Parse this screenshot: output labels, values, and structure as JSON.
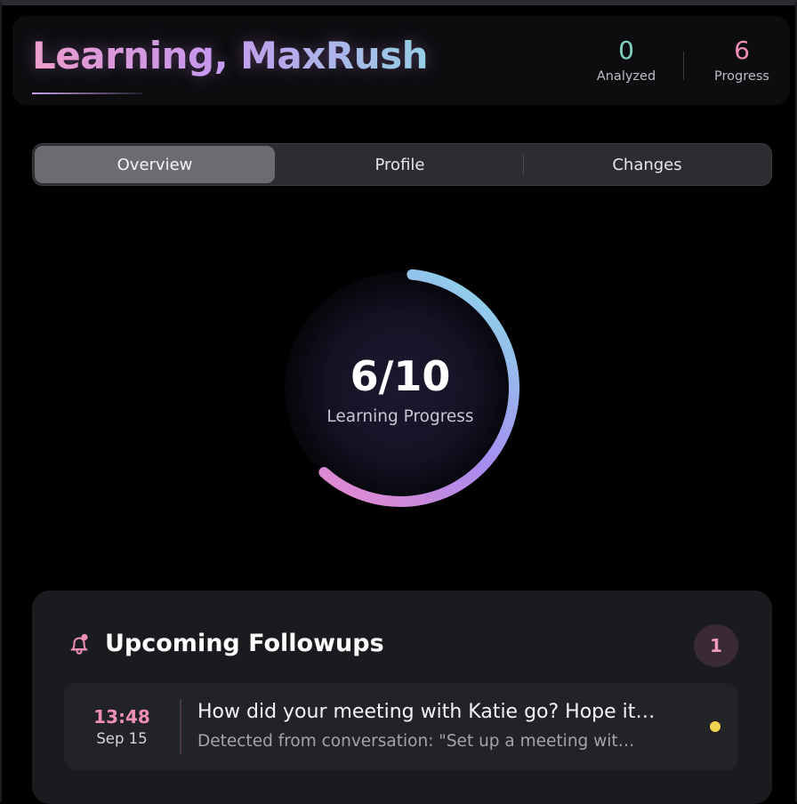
{
  "header": {
    "title": "Learning, MaxRush",
    "stats": {
      "analyzed": {
        "value": "0",
        "label": "Analyzed"
      },
      "progress": {
        "value": "6",
        "label": "Progress"
      }
    }
  },
  "tabs": [
    {
      "label": "Overview",
      "active": true
    },
    {
      "label": "Profile",
      "active": false
    },
    {
      "label": "Changes",
      "active": false
    }
  ],
  "progress_ring": {
    "value_text": "6/10",
    "label": "Learning Progress",
    "current": 6,
    "total": 10
  },
  "followups": {
    "icon": "bell-icon",
    "title": "Upcoming Followups",
    "count": "1",
    "items": [
      {
        "time": "13:48",
        "date": "Sep 15",
        "title": "How did your meeting with Katie go? Hope it…",
        "subtitle": "Detected from conversation: \"Set up a meeting wit…",
        "status_color": "#f3d150"
      }
    ]
  },
  "colors": {
    "accent_pink": "#ef8fb3",
    "accent_teal": "#7fd3c5",
    "ring_gradient": [
      "#8fd0ea",
      "#a68bf0",
      "#e28ad0"
    ]
  }
}
